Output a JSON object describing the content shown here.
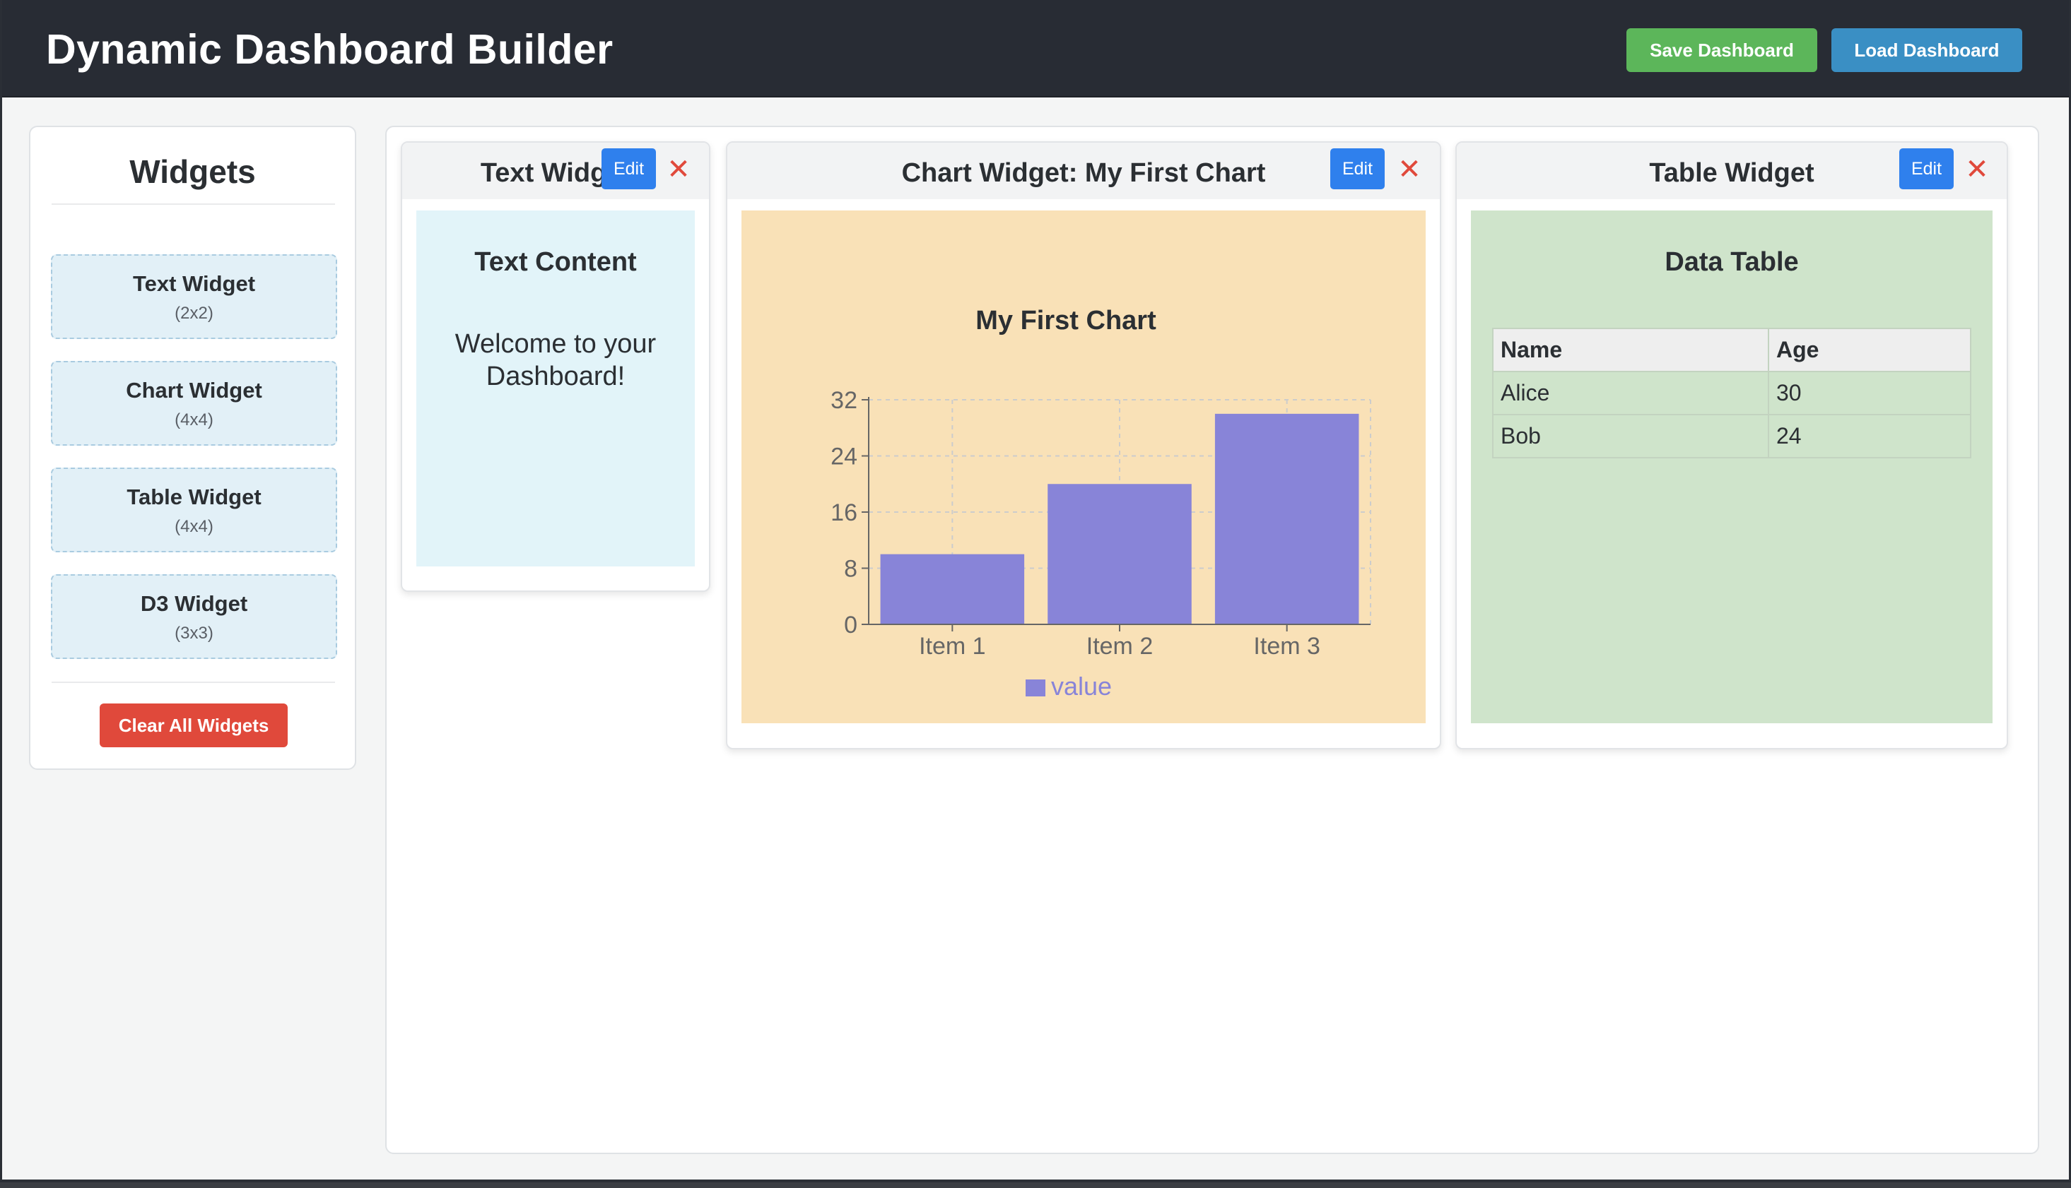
{
  "header": {
    "title": "Dynamic Dashboard Builder",
    "save_label": "Save Dashboard",
    "load_label": "Load Dashboard"
  },
  "sidebar": {
    "title": "Widgets",
    "items": [
      {
        "label": "Text Widget",
        "size": "(2x2)"
      },
      {
        "label": "Chart Widget",
        "size": "(4x4)"
      },
      {
        "label": "Table Widget",
        "size": "(4x4)"
      },
      {
        "label": "D3 Widget",
        "size": "(3x3)"
      }
    ],
    "clear_label": "Clear All Widgets"
  },
  "widgets": {
    "edit_label": "Edit",
    "close_symbol": "✕",
    "text": {
      "title": "Text Widget",
      "heading": "Text Content",
      "content": "Welcome to your Dashboard!"
    },
    "chart": {
      "title": "Chart Widget: My First Chart"
    },
    "table": {
      "title": "Table Widget",
      "heading": "Data Table",
      "columns": [
        "Name",
        "Age"
      ],
      "rows": [
        [
          "Alice",
          "30"
        ],
        [
          "Bob",
          "24"
        ]
      ]
    }
  },
  "chart_data": {
    "type": "bar",
    "title": "My First Chart",
    "categories": [
      "Item 1",
      "Item 2",
      "Item 3"
    ],
    "series": [
      {
        "name": "value",
        "values": [
          10,
          20,
          30
        ]
      }
    ],
    "ylim": [
      0,
      32
    ],
    "yticks": [
      0,
      8,
      16,
      24,
      32
    ],
    "grid": true,
    "legend": "bottom",
    "bar_color": "#8884d8"
  },
  "colors": {
    "header_bg": "#282c34",
    "save": "#5cb65a",
    "load": "#3a8fc4",
    "clear": "#e0493b",
    "edit": "#2f80ed"
  }
}
